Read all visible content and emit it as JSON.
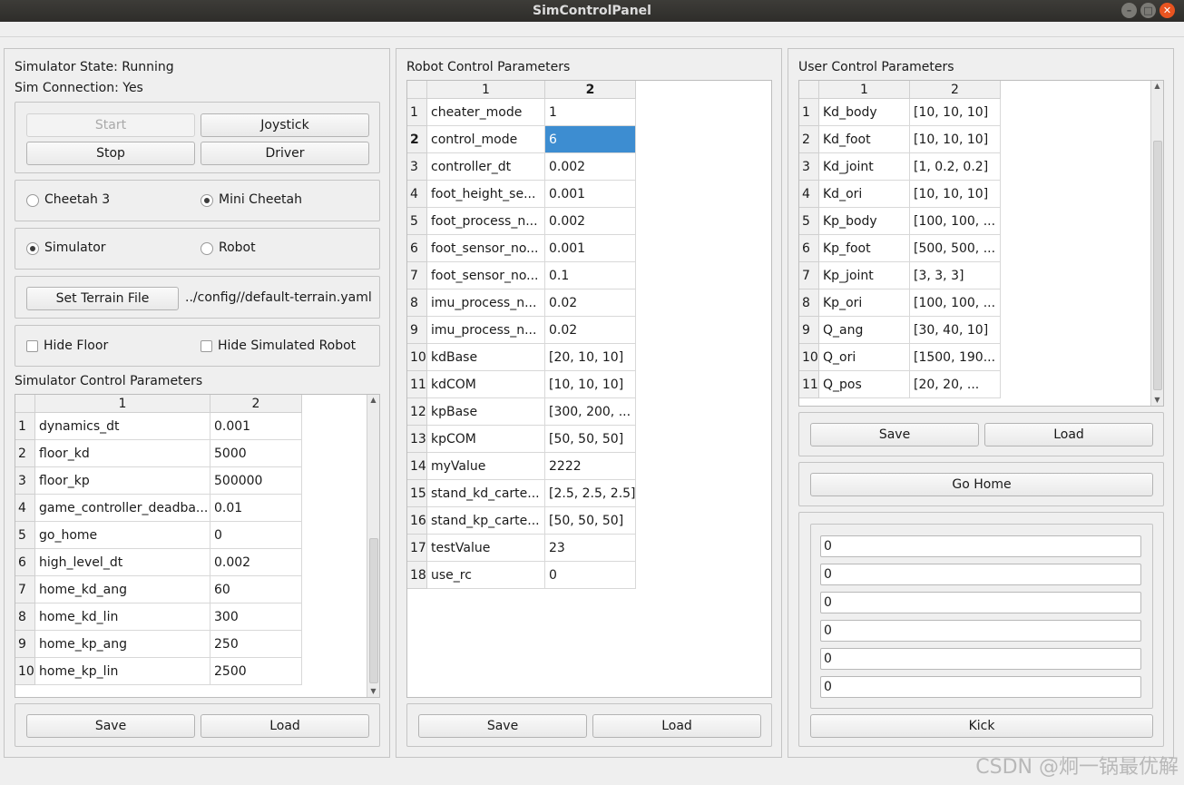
{
  "window": {
    "title": "SimControlPanel"
  },
  "left": {
    "state": "Simulator State: Running",
    "connection": "Sim Connection: Yes",
    "buttons": {
      "start": "Start",
      "joystick": "Joystick",
      "stop": "Stop",
      "driver": "Driver"
    },
    "robot_radios": [
      {
        "label": "Cheetah 3",
        "checked": false
      },
      {
        "label": "Mini Cheetah",
        "checked": true
      }
    ],
    "mode_radios": [
      {
        "label": "Simulator",
        "checked": true
      },
      {
        "label": "Robot",
        "checked": false
      }
    ],
    "terrain_button": "Set Terrain File",
    "terrain_path": "../config//default-terrain.yaml",
    "hide_floor": "Hide Floor",
    "hide_robot": "Hide Simulated Robot",
    "table_title": "Simulator Control Parameters",
    "table_headers": [
      "1",
      "2"
    ],
    "rows": [
      {
        "n": "1",
        "name": "dynamics_dt",
        "value": "0.001"
      },
      {
        "n": "2",
        "name": "floor_kd",
        "value": "5000"
      },
      {
        "n": "3",
        "name": "floor_kp",
        "value": "500000"
      },
      {
        "n": "4",
        "name": "game_controller_deadba...",
        "value": "0.01"
      },
      {
        "n": "5",
        "name": "go_home",
        "value": "0"
      },
      {
        "n": "6",
        "name": "high_level_dt",
        "value": "0.002"
      },
      {
        "n": "7",
        "name": "home_kd_ang",
        "value": "60"
      },
      {
        "n": "8",
        "name": "home_kd_lin",
        "value": "300"
      },
      {
        "n": "9",
        "name": "home_kp_ang",
        "value": "250"
      },
      {
        "n": "10",
        "name": "home_kp_lin",
        "value": "2500"
      }
    ],
    "save": "Save",
    "load": "Load"
  },
  "middle": {
    "table_title": "Robot Control Parameters",
    "table_headers": [
      "1",
      "2"
    ],
    "rows": [
      {
        "n": "1",
        "name": "cheater_mode",
        "value": "1"
      },
      {
        "n": "2",
        "name": "control_mode",
        "value": "6",
        "selected": true
      },
      {
        "n": "3",
        "name": "controller_dt",
        "value": "0.002"
      },
      {
        "n": "4",
        "name": "foot_height_se...",
        "value": "0.001"
      },
      {
        "n": "5",
        "name": "foot_process_n...",
        "value": "0.002"
      },
      {
        "n": "6",
        "name": "foot_sensor_no...",
        "value": "0.001"
      },
      {
        "n": "7",
        "name": "foot_sensor_no...",
        "value": "0.1"
      },
      {
        "n": "8",
        "name": "imu_process_n...",
        "value": "0.02"
      },
      {
        "n": "9",
        "name": "imu_process_n...",
        "value": "0.02"
      },
      {
        "n": "10",
        "name": "kdBase",
        "value": "[20, 10, 10]"
      },
      {
        "n": "11",
        "name": "kdCOM",
        "value": "[10, 10, 10]"
      },
      {
        "n": "12",
        "name": "kpBase",
        "value": "[300, 200, ..."
      },
      {
        "n": "13",
        "name": "kpCOM",
        "value": "[50, 50, 50]"
      },
      {
        "n": "14",
        "name": "myValue",
        "value": "2222"
      },
      {
        "n": "15",
        "name": "stand_kd_carte...",
        "value": "[2.5, 2.5, 2.5]"
      },
      {
        "n": "16",
        "name": "stand_kp_carte...",
        "value": "[50, 50, 50]"
      },
      {
        "n": "17",
        "name": "testValue",
        "value": "23"
      },
      {
        "n": "18",
        "name": "use_rc",
        "value": "0"
      }
    ],
    "save": "Save",
    "load": "Load"
  },
  "right": {
    "table_title": "User Control Parameters",
    "table_headers": [
      "1",
      "2"
    ],
    "rows": [
      {
        "n": "1",
        "name": "Kd_body",
        "value": "[10, 10, 10]"
      },
      {
        "n": "2",
        "name": "Kd_foot",
        "value": "[10, 10, 10]"
      },
      {
        "n": "3",
        "name": "Kd_joint",
        "value": "[1, 0.2, 0.2]"
      },
      {
        "n": "4",
        "name": "Kd_ori",
        "value": "[10, 10, 10]"
      },
      {
        "n": "5",
        "name": "Kp_body",
        "value": "[100, 100, ..."
      },
      {
        "n": "6",
        "name": "Kp_foot",
        "value": "[500, 500, ..."
      },
      {
        "n": "7",
        "name": "Kp_joint",
        "value": "[3, 3, 3]"
      },
      {
        "n": "8",
        "name": "Kp_ori",
        "value": "[100, 100, ..."
      },
      {
        "n": "9",
        "name": "Q_ang",
        "value": "[30, 40, 10]"
      },
      {
        "n": "10",
        "name": "Q_ori",
        "value": "[1500, 190..."
      },
      {
        "n": "11",
        "name": "Q_pos",
        "value": "[20, 20, ..."
      }
    ],
    "save": "Save",
    "load": "Load",
    "go_home": "Go Home",
    "fields": [
      "0",
      "0",
      "0",
      "0",
      "0",
      "0"
    ],
    "kick": "Kick"
  },
  "watermark": "CSDN @炯一锅最优解"
}
